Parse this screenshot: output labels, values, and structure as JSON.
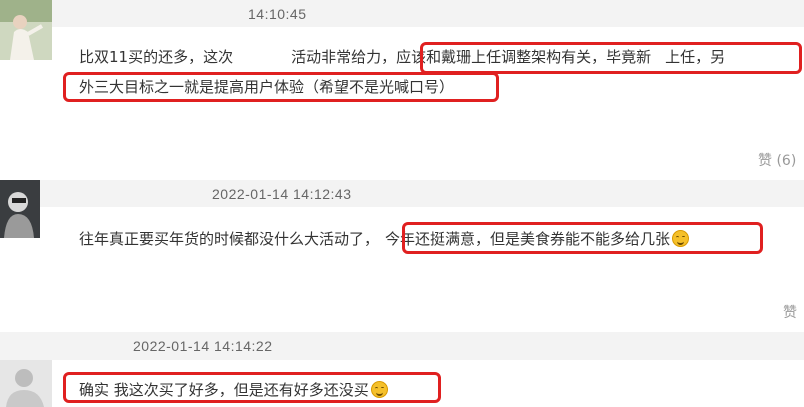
{
  "comments": [
    {
      "timestamp": "14:10:45",
      "line1_prefix": "比双11买的还多，这次",
      "line1_mid": "活动非常给力，",
      "line1_hl_a": "应该和戴珊上任调整架构有关，毕竟新",
      "line1_hl_b": "上任，另",
      "line2_hl": "外三大目标之一就是提高用户体验（希望不是光喊口号）",
      "likes": "赞 (6)"
    },
    {
      "timestamp": "2022-01-14 14:12:43",
      "text_plain": "往年真正要买年货的时候都没什么大活动了，",
      "text_hl": "今年还挺满意，但是美食券能不能多给几张",
      "emoji": "smile-emoji",
      "likes": "赞"
    },
    {
      "timestamp": "2022-01-14 14:14:22",
      "text_hl": "确实 我这次买了好多，但是还有好多还没买",
      "emoji": "laugh-emoji"
    }
  ]
}
